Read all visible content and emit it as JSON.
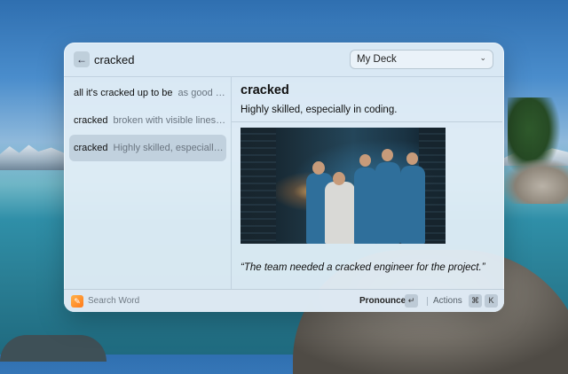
{
  "search": {
    "value": "cracked"
  },
  "deck": {
    "selected": "My Deck"
  },
  "icons": {
    "back": "arrow-left-icon",
    "chevron": "chevron-down-icon",
    "logo": "app-logo-icon",
    "enter": "return-key-icon",
    "command": "command-key-icon"
  },
  "results": [
    {
      "term": "all it's cracked up to be",
      "definition": "as good as expected or claimed"
    },
    {
      "term": "cracked",
      "definition": "broken with visible lines on the surface"
    },
    {
      "term": "cracked",
      "definition": "Highly skilled, especially in coding."
    }
  ],
  "detail": {
    "title": "cracked",
    "definition": "Highly skilled, especially in coding.",
    "example": "“The team needed a cracked engineer for the project.”"
  },
  "footer": {
    "search_hint": "Search Word",
    "pronounce_label": "Pronounce",
    "enter_key": "↵",
    "actions_label": "Actions",
    "command_key": "⌘",
    "k_key": "K"
  },
  "colors": {
    "accent_logo": "#ff8a24",
    "selected_row": "#b7c7d3"
  }
}
